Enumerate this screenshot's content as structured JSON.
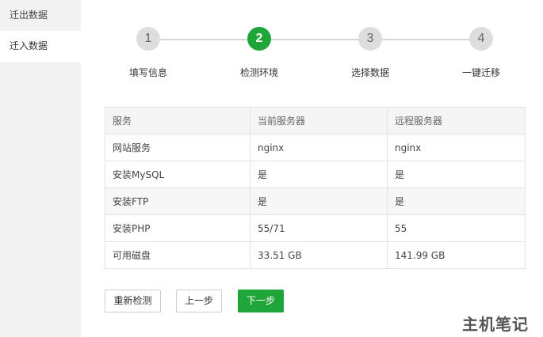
{
  "sidebar": {
    "items": [
      {
        "label": "迁出数据"
      },
      {
        "label": "迁入数据"
      }
    ]
  },
  "stepper": {
    "current_step": 2,
    "steps": [
      {
        "number": "1",
        "label": "填写信息"
      },
      {
        "number": "2",
        "label": "检测环境"
      },
      {
        "number": "3",
        "label": "选择数据"
      },
      {
        "number": "4",
        "label": "一键迁移"
      }
    ]
  },
  "table": {
    "headers": [
      "服务",
      "当前服务器",
      "远程服务器"
    ],
    "rows": [
      [
        "网站服务",
        "nginx",
        "nginx"
      ],
      [
        "安装MySQL",
        "是",
        "是"
      ],
      [
        "安装FTP",
        "是",
        "是"
      ],
      [
        "安装PHP",
        "55/71",
        "55"
      ],
      [
        "可用磁盘",
        "33.51 GB",
        "141.99 GB"
      ]
    ]
  },
  "buttons": {
    "recheck": "重新检测",
    "prev": "上一步",
    "next": "下一步"
  },
  "watermark": "主机笔记",
  "colors": {
    "accent": "#20a53a",
    "sidebar_bg": "#f2f2f2",
    "inactive_step": "#dddddd"
  }
}
